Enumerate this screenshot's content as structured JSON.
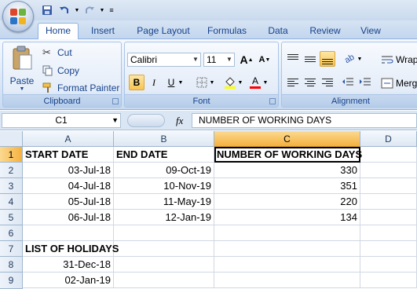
{
  "qat": {
    "save_icon": "save-icon",
    "undo_icon": "undo-icon",
    "redo_icon": "redo-icon",
    "customize_icon": "customize-qat-icon"
  },
  "tabs": [
    {
      "label": "Home"
    },
    {
      "label": "Insert"
    },
    {
      "label": "Page Layout"
    },
    {
      "label": "Formulas"
    },
    {
      "label": "Data"
    },
    {
      "label": "Review"
    },
    {
      "label": "View"
    }
  ],
  "ribbon": {
    "clipboard": {
      "label": "Clipboard",
      "paste": "Paste",
      "cut": "Cut",
      "copy": "Copy",
      "format_painter": "Format Painter"
    },
    "font": {
      "label": "Font",
      "font_name": "Calibri",
      "font_size": "11",
      "bold": "B",
      "italic": "I",
      "underline": "U",
      "grow": "A",
      "shrink": "A",
      "font_color_letter": "A",
      "fill_color": "#ffff00",
      "font_color": "#ff0000"
    },
    "alignment": {
      "label": "Alignment",
      "wrap": "Wrap",
      "merge": "Merg"
    }
  },
  "formula_bar": {
    "name_box": "C1",
    "fx": "fx",
    "content": "NUMBER OF WORKING DAYS"
  },
  "sheet": {
    "columns": [
      "A",
      "B",
      "C",
      "D"
    ],
    "rows": [
      "1",
      "2",
      "3",
      "4",
      "5",
      "6",
      "7",
      "8",
      "9"
    ],
    "cells": {
      "A1": "START DATE",
      "B1": "END DATE",
      "C1": "NUMBER OF WORKING DAYS",
      "A2": "03-Jul-18",
      "B2": "09-Oct-19",
      "C2": "330",
      "A3": "04-Jul-18",
      "B3": "10-Nov-19",
      "C3": "351",
      "A4": "05-Jul-18",
      "B4": "11-May-19",
      "C4": "220",
      "A5": "06-Jul-18",
      "B5": "12-Jan-19",
      "C5": "134",
      "A7": "LIST OF HOLIDAYS",
      "A8": "31-Dec-18",
      "A9": "02-Jan-19"
    }
  }
}
